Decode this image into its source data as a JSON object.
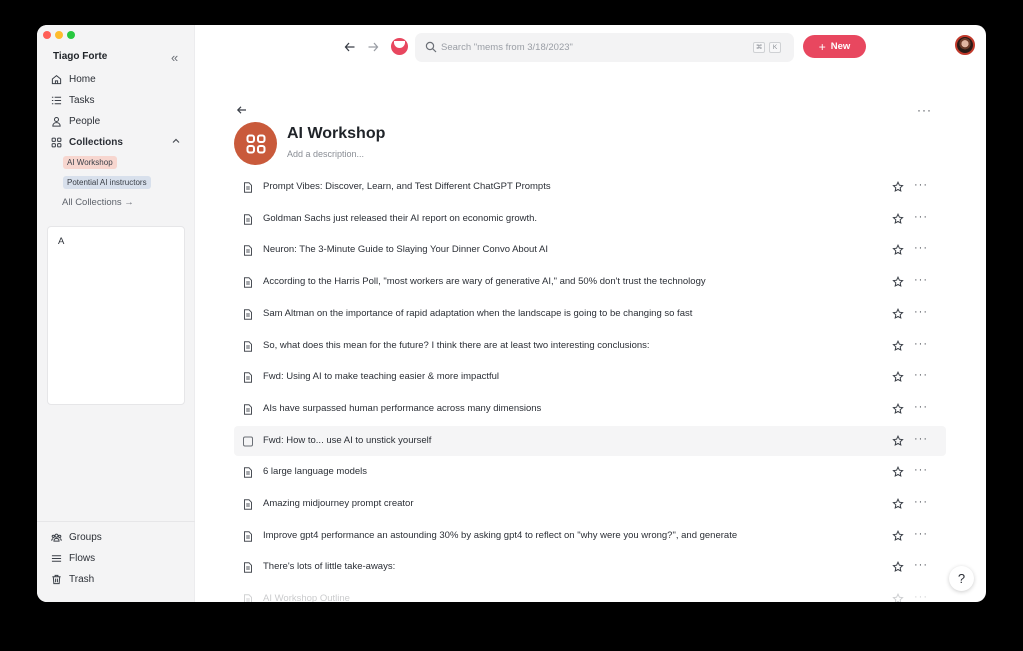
{
  "sidebar": {
    "user_name": "Tiago Forte",
    "nav": [
      {
        "label": "Home",
        "icon": "home-icon"
      },
      {
        "label": "Tasks",
        "icon": "tasks-icon"
      },
      {
        "label": "People",
        "icon": "person-icon"
      },
      {
        "label": "Collections",
        "icon": "grid-icon"
      }
    ],
    "collections": [
      {
        "label": "AI Workshop"
      },
      {
        "label": "Potential AI instructors"
      }
    ],
    "all_collections_label": "All Collections →",
    "box_text": "A",
    "bottom_nav": [
      {
        "label": "Groups",
        "icon": "groups-icon"
      },
      {
        "label": "Flows",
        "icon": "flows-icon"
      },
      {
        "label": "Trash",
        "icon": "trash-icon"
      }
    ]
  },
  "topbar": {
    "search_placeholder": "Search \"mems from 3/18/2023\"",
    "kbd_1": "⌘",
    "kbd_2": "K",
    "new_button_label": "New"
  },
  "collection": {
    "title": "AI Workshop",
    "description_placeholder": "Add a description..."
  },
  "items": [
    {
      "title": "Prompt Vibes: Discover, Learn, and Test Different ChatGPT Prompts"
    },
    {
      "title": "Goldman Sachs just released their AI report on economic growth."
    },
    {
      "title": "Neuron: The 3-Minute Guide to Slaying Your Dinner Convo About AI"
    },
    {
      "title": "According to the Harris Poll, \"most workers are wary of generative AI,\" and 50% don't trust the technology"
    },
    {
      "title": "Sam Altman on the importance of rapid adaptation when the landscape is going to be changing so fast"
    },
    {
      "title": "So, what does this mean for the future? I think there are at least two interesting conclusions:"
    },
    {
      "title": "Fwd: Using AI to make teaching easier & more impactful"
    },
    {
      "title": "AIs have surpassed human performance across many dimensions"
    },
    {
      "title": "Fwd: How to... use AI to unstick yourself"
    },
    {
      "title": "6 large language models"
    },
    {
      "title": "Amazing midjourney prompt creator"
    },
    {
      "title": "Improve gpt4 performance an astounding 30% by asking gpt4 to reflect on \"why were you wrong?\", and generate"
    },
    {
      "title": "There's lots of little take-aways:"
    },
    {
      "title": "AI Workshop Outline"
    }
  ],
  "help_label": "?",
  "colors": {
    "accent": "#e8475f",
    "collection_icon_bg": "#c95a3b",
    "tag_ai_workshop": "#f7d6cf",
    "tag_potential": "#d8e0ec"
  }
}
